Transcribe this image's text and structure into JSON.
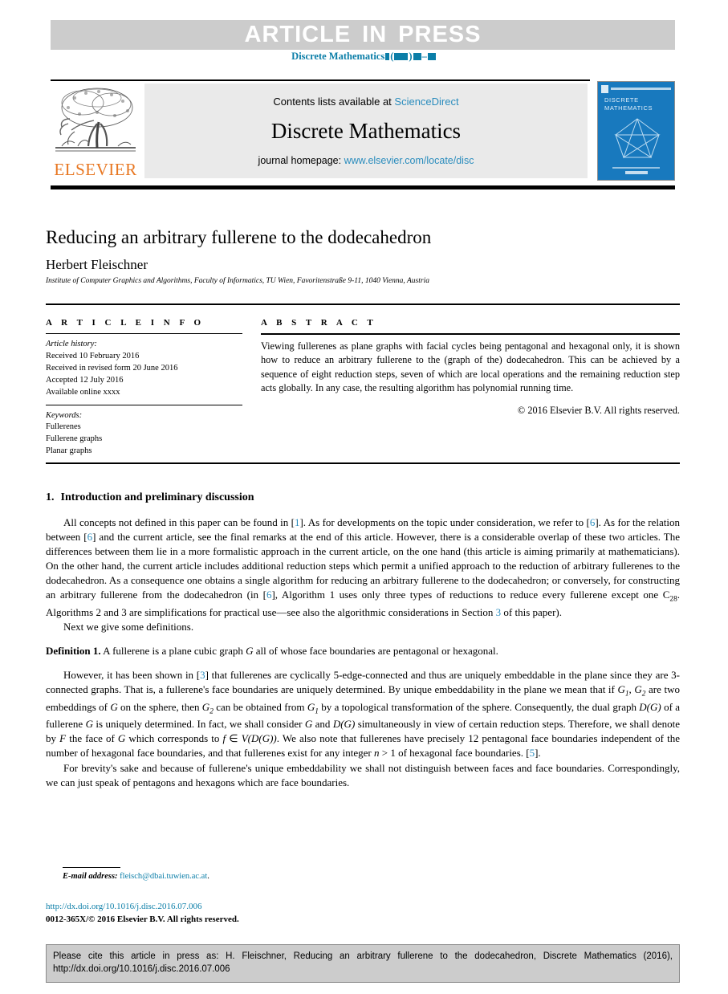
{
  "banner": {
    "text_part1": "ARTICLE",
    "text_part2": "IN",
    "text_part3": "PRESS",
    "background": "#cccccc",
    "text_color": "#ffffff"
  },
  "journal_ref": {
    "name": "Discrete Mathematics",
    "color": "#0b7ea8"
  },
  "masthead": {
    "contents_prefix": "Contents lists available at ",
    "contents_link": "ScienceDirect",
    "journal_name": "Discrete Mathematics",
    "homepage_prefix": "journal homepage: ",
    "homepage_link": "www.elsevier.com/locate/disc",
    "publisher_logo_text": "ELSEVIER",
    "publisher_logo_color": "#e87722",
    "link_color": "#2a8cbd"
  },
  "cover": {
    "title_line1": "DISCRETE",
    "title_line2": "MATHEMATICS",
    "background": "#1879be"
  },
  "article": {
    "title": "Reducing an arbitrary fullerene to the dodecahedron",
    "author": "Herbert Fleischner",
    "affiliation": "Institute of Computer Graphics and Algorithms, Faculty of Informatics, TU Wien, Favoritenstraße 9-11, 1040 Vienna, Austria"
  },
  "article_info": {
    "heading": "A R T I C L E   I N F O",
    "history_label": "Article history:",
    "history": [
      "Received 10 February 2016",
      "Received in revised form 20 June 2016",
      "Accepted 12 July 2016",
      "Available online xxxx"
    ],
    "keywords_label": "Keywords:",
    "keywords": [
      "Fullerenes",
      "Fullerene graphs",
      "Planar graphs"
    ]
  },
  "abstract": {
    "heading": "A B S T R A C T",
    "text": "Viewing fullerenes as plane graphs with facial cycles being pentagonal and hexagonal only, it is shown how to reduce an arbitrary fullerene to the (graph of the) dodecahedron. This can be achieved by a sequence of eight reduction steps, seven of which are local operations and the remaining reduction step acts globally. In any case, the resulting algorithm has polynomial running time.",
    "copyright": "© 2016 Elsevier B.V. All rights reserved."
  },
  "body": {
    "section_number": "1.",
    "section_title": "Introduction and preliminary discussion",
    "para1_a": "All concepts not defined in this paper can be found in [",
    "para1_ref1": "1",
    "para1_b": "]. As for developments on the topic under consideration, we refer to [",
    "para1_ref2": "6",
    "para1_c": "]. As for the relation between [",
    "para1_ref3": "6",
    "para1_d": "] and the current article, see the final remarks at the end of this article. However, there is a considerable overlap of these two articles. The differences between them lie in a more formalistic approach in the current article, on the one hand (this article is aiming primarily at mathematicians). On the other hand, the current article includes additional reduction steps which permit a unified approach to the reduction of arbitrary fullerenes to the dodecahedron. As a consequence one obtains a single algorithm for reducing an arbitrary fullerene to the dodecahedron; or conversely, for constructing an arbitrary fullerene from the dodecahedron (in [",
    "para1_ref4": "6",
    "para1_e": "], Algorithm 1 uses only three types of reductions to reduce every fullerene except one C",
    "para1_sub": "28",
    "para1_f": ". Algorithms 2 and 3 are simplifications for practical use—see also the algorithmic considerations in Section ",
    "para1_ref5": "3",
    "para1_g": " of this paper).",
    "para2": "Next we give some definitions.",
    "def_label": "Definition 1.",
    "def_text_a": " A fullerene is a plane cubic graph ",
    "def_G": "G",
    "def_text_b": " all of whose face boundaries are pentagonal or hexagonal.",
    "para3_a": "However, it has been shown in [",
    "para3_ref1": "3",
    "para3_b": "] that fullerenes are cyclically 5-edge-connected and thus are uniquely embeddable in the plane since they are 3-connected graphs. That is, a fullerene's face boundaries are uniquely determined. By unique embeddability in the plane we mean that if ",
    "para3_c": " are two embeddings of ",
    "para3_d": " on the sphere, then ",
    "para3_e": " can be obtained from ",
    "para3_f": " by a topological transformation of the sphere. Consequently, the dual graph ",
    "para3_g": " of a fullerene ",
    "para3_h": " is uniquely determined. In fact, we shall consider ",
    "para3_i": " and ",
    "para3_j": " simultaneously in view of certain reduction steps. Therefore, we shall denote by ",
    "para3_k": " the face of ",
    "para3_l": " which corresponds to ",
    "para3_m": ". We also note that fullerenes have precisely 12 pentagonal face boundaries independent of the number of hexagonal face boundaries, and that fullerenes exist for any integer ",
    "para3_n": " of hexagonal face boundaries. [",
    "para3_ref2": "5",
    "para3_o": "].",
    "para4": "For brevity's sake and because of fullerene's unique embeddability we shall not distinguish between faces and face boundaries. Correspondingly, we can just speak of pentagons and hexagons which are face boundaries."
  },
  "footer": {
    "email_label": "E-mail address:",
    "email": "fleisch@dbai.tuwien.ac.at",
    "email_suffix": ".",
    "doi": "http://dx.doi.org/10.1016/j.disc.2016.07.006",
    "issn_line": "0012-365X/© 2016 Elsevier B.V. All rights reserved.",
    "link_color": "#0b7ea8"
  },
  "cite_box": {
    "line1": "Please cite this article in press as: H. Fleischner, Reducing an arbitrary fullerene to the dodecahedron, Discrete Mathematics (2016),",
    "line2": "http://dx.doi.org/10.1016/j.disc.2016.07.006",
    "background": "#cccccc"
  }
}
